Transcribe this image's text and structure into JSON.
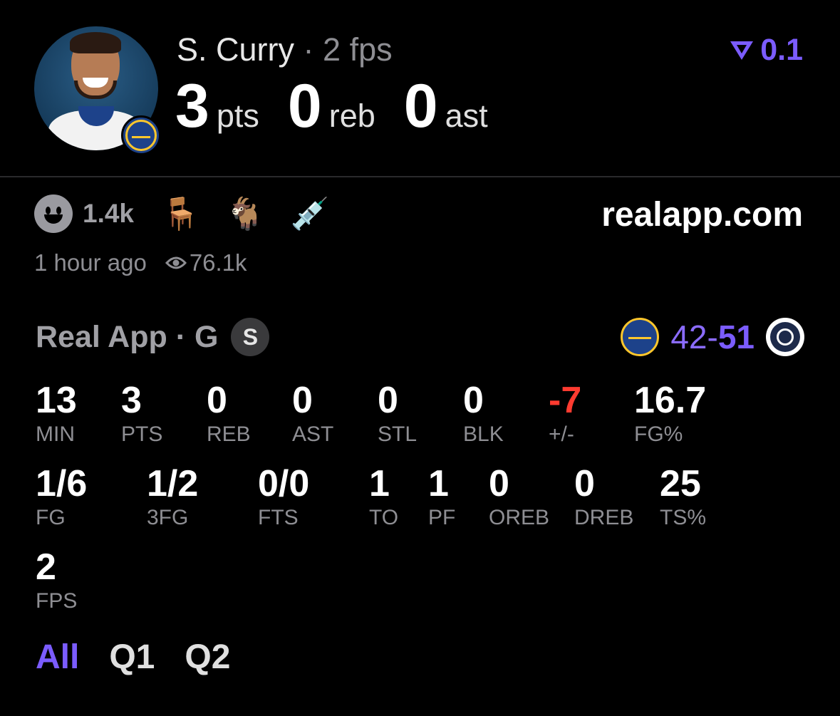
{
  "player": {
    "name": "S. Curry",
    "separator": "·",
    "fps_label": "2 fps",
    "points": "3",
    "points_unit": "pts",
    "rebounds": "0",
    "rebounds_unit": "reb",
    "assists": "0",
    "assists_unit": "ast"
  },
  "vote": {
    "value": "0.1",
    "color": "#7b5cff"
  },
  "reactions": {
    "count": "1.4k",
    "emojis": [
      "🪑",
      "🐐",
      "💉"
    ],
    "emoji_names": [
      "chair-icon",
      "goat-icon",
      "syringe-icon"
    ]
  },
  "site": "realapp.com",
  "meta": {
    "time": "1 hour ago",
    "views": "76.1k"
  },
  "game": {
    "title": "Real App · G",
    "badge": "S",
    "score_left": "42",
    "score_dash": "-",
    "score_right": "51"
  },
  "stats_row1": [
    {
      "value": "13",
      "label": "MIN"
    },
    {
      "value": "3",
      "label": "PTS"
    },
    {
      "value": "0",
      "label": "REB"
    },
    {
      "value": "0",
      "label": "AST"
    },
    {
      "value": "0",
      "label": "STL"
    },
    {
      "value": "0",
      "label": "BLK"
    },
    {
      "value": "-7",
      "label": "+/-"
    },
    {
      "value": "16.7",
      "label": "FG%"
    }
  ],
  "stats_row2": [
    {
      "value": "1/6",
      "label": "FG"
    },
    {
      "value": "1/2",
      "label": "3FG"
    },
    {
      "value": "0/0",
      "label": "FTS"
    },
    {
      "value": "1",
      "label": "TO"
    },
    {
      "value": "1",
      "label": "PF"
    },
    {
      "value": "0",
      "label": "OREB"
    },
    {
      "value": "0",
      "label": "DREB"
    },
    {
      "value": "25",
      "label": "TS%"
    }
  ],
  "stats_row3": [
    {
      "value": "2",
      "label": "FPS"
    }
  ],
  "tabs": [
    "All",
    "Q1",
    "Q2"
  ],
  "colors": {
    "accent": "#7b5cff",
    "negative": "#ff3b30",
    "muted": "#8e8e93"
  }
}
